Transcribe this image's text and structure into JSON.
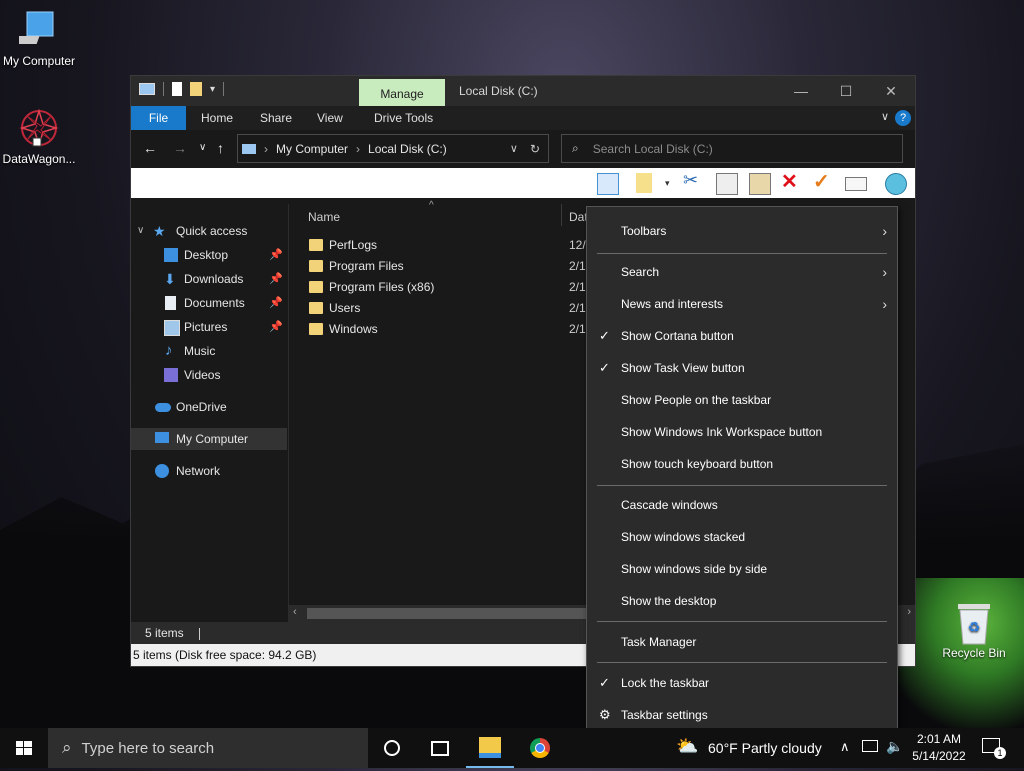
{
  "desktop": {
    "icons": [
      {
        "label": "My Computer"
      },
      {
        "label": "DataWagon..."
      },
      {
        "label": "Recycle Bin"
      }
    ]
  },
  "window": {
    "title": "Local Disk (C:)",
    "manage_tab": "Manage",
    "ribbon_tabs": [
      "File",
      "Home",
      "Share",
      "View",
      "Drive Tools"
    ],
    "breadcrumb": [
      "My Computer",
      "Local Disk (C:)"
    ],
    "search_placeholder": "Search Local Disk (C:)",
    "nav": {
      "quick_access": "Quick access",
      "items": [
        {
          "label": "Desktop",
          "pinned": true
        },
        {
          "label": "Downloads",
          "pinned": true
        },
        {
          "label": "Documents",
          "pinned": true
        },
        {
          "label": "Pictures",
          "pinned": true
        },
        {
          "label": "Music",
          "pinned": false
        },
        {
          "label": "Videos",
          "pinned": false
        }
      ],
      "onedrive": "OneDrive",
      "my_computer": "My Computer",
      "network": "Network"
    },
    "columns": {
      "name": "Name",
      "date": "Dat"
    },
    "files": [
      {
        "name": "PerfLogs",
        "date": "12/"
      },
      {
        "name": "Program Files",
        "date": "2/1"
      },
      {
        "name": "Program Files (x86)",
        "date": "2/1"
      },
      {
        "name": "Users",
        "date": "2/1"
      },
      {
        "name": "Windows",
        "date": "2/1"
      }
    ],
    "status_count": "5 items",
    "status_detail": "5 items (Disk free space: 94.2 GB)"
  },
  "context_menu": {
    "items": [
      {
        "label": "Toolbars",
        "submenu": true,
        "checked": false
      },
      {
        "label": "Search",
        "submenu": true,
        "checked": false
      },
      {
        "label": "News and interests",
        "submenu": true,
        "checked": false
      },
      {
        "label": "Show Cortana button",
        "submenu": false,
        "checked": true
      },
      {
        "label": "Show Task View button",
        "submenu": false,
        "checked": true
      },
      {
        "label": "Show People on the taskbar",
        "submenu": false,
        "checked": false
      },
      {
        "label": "Show Windows Ink Workspace button",
        "submenu": false,
        "checked": false
      },
      {
        "label": "Show touch keyboard button",
        "submenu": false,
        "checked": false
      },
      {
        "label": "Cascade windows",
        "submenu": false,
        "checked": false
      },
      {
        "label": "Show windows stacked",
        "submenu": false,
        "checked": false
      },
      {
        "label": "Show windows side by side",
        "submenu": false,
        "checked": false
      },
      {
        "label": "Show the desktop",
        "submenu": false,
        "checked": false
      },
      {
        "label": "Task Manager",
        "submenu": false,
        "checked": false
      },
      {
        "label": "Lock the taskbar",
        "submenu": false,
        "checked": true
      },
      {
        "label": "Taskbar settings",
        "submenu": false,
        "checked": false
      }
    ]
  },
  "taskbar": {
    "search_placeholder": "Type here to search",
    "weather": "60°F  Partly cloudy",
    "time": "2:01 AM",
    "date": "5/14/2022",
    "notification_count": "1"
  },
  "colors": {
    "accent": "#1979ca",
    "manage_tab": "#c9ecbf",
    "folder": "#f3d37a"
  }
}
